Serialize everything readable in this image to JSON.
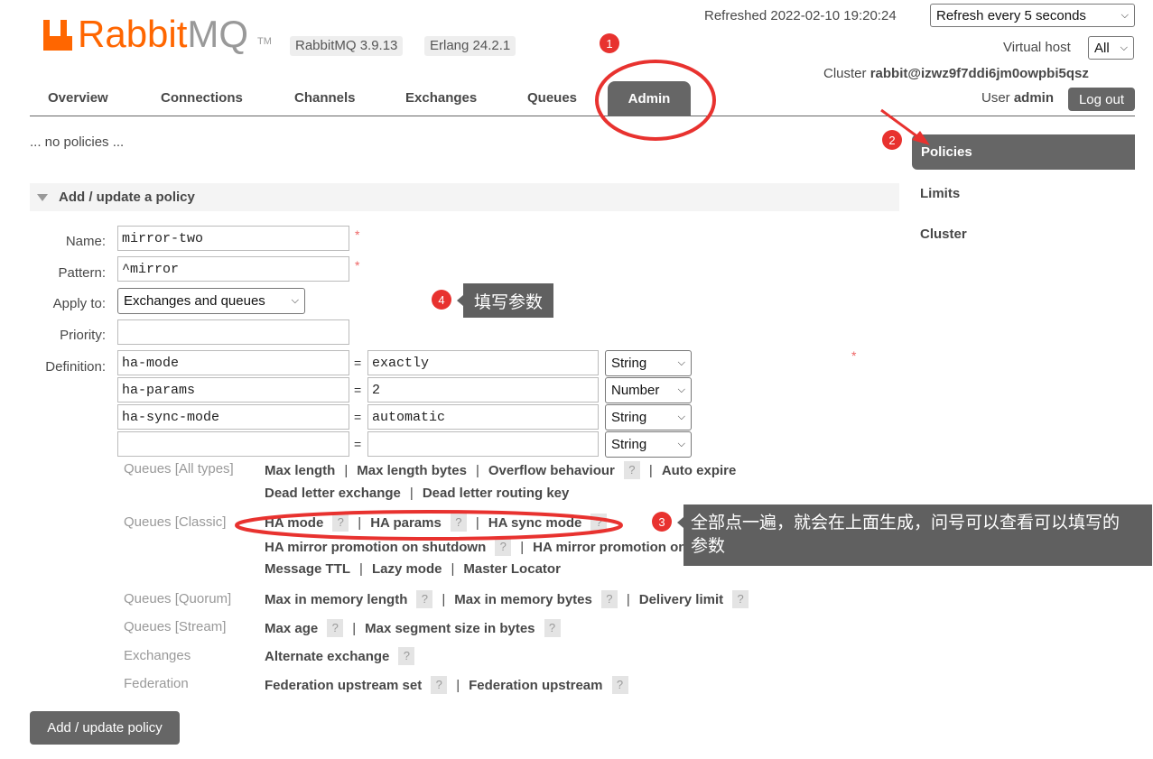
{
  "header": {
    "logo_text_1": "Rabbit",
    "logo_text_2": "MQ",
    "tm": "TM",
    "version": "RabbitMQ 3.9.13",
    "erlang": "Erlang 24.2.1",
    "refreshed_label": "Refreshed 2022-02-10 19:20:24",
    "refresh_select": "Refresh every 5 seconds",
    "vhost_label": "Virtual host",
    "vhost_select": "All",
    "cluster_label": "Cluster",
    "cluster_name": "rabbit@izwz9f7ddi6jm0owpbi5qsz",
    "user_label": "User",
    "user_name": "admin",
    "logout": "Log out"
  },
  "tabs": [
    "Overview",
    "Connections",
    "Channels",
    "Exchanges",
    "Queues",
    "Admin"
  ],
  "sidebar": {
    "items": [
      "Policies",
      "Limits",
      "Cluster"
    ]
  },
  "main": {
    "no_policies": "... no policies ...",
    "section_title": "Add / update a policy",
    "form": {
      "name_label": "Name:",
      "name_value": "mirror-two",
      "pattern_label": "Pattern:",
      "pattern_value": "^mirror",
      "apply_label": "Apply to:",
      "apply_value": "Exchanges and queues",
      "priority_label": "Priority:",
      "priority_value": "",
      "definition_label": "Definition:",
      "required": "*",
      "equals": "=",
      "definition": [
        {
          "key": "ha-mode",
          "value": "exactly",
          "type": "String"
        },
        {
          "key": "ha-params",
          "value": "2",
          "type": "Number"
        },
        {
          "key": "ha-sync-mode",
          "value": "automatic",
          "type": "String"
        },
        {
          "key": "",
          "value": "",
          "type": "String"
        }
      ]
    },
    "help": {
      "cat_all": "Queues [All types]",
      "cat_classic": "Queues [Classic]",
      "cat_quorum": "Queues [Quorum]",
      "cat_stream": "Queues [Stream]",
      "cat_exchanges": "Exchanges",
      "cat_federation": "Federation",
      "q": "?",
      "sep": "|",
      "all_1": "Max length",
      "all_2": "Max length bytes",
      "all_3": "Overflow behaviour",
      "all_4": "Auto expire",
      "all_5": "Dead letter exchange",
      "all_6": "Dead letter routing key",
      "classic_1": "HA mode",
      "classic_2": "HA params",
      "classic_3": "HA sync mode",
      "classic_4": "HA mirror promotion on shutdown",
      "classic_5": "HA mirror promotion on failure",
      "classic_6": "Message TTL",
      "classic_7": "Lazy mode",
      "classic_8": "Master Locator",
      "quorum_1": "Max in memory length",
      "quorum_2": "Max in memory bytes",
      "quorum_3": "Delivery limit",
      "stream_1": "Max age",
      "stream_2": "Max segment size in bytes",
      "exch_1": "Alternate exchange",
      "fed_1": "Federation upstream set",
      "fed_2": "Federation upstream"
    },
    "submit": "Add / update policy"
  },
  "annotations": {
    "n1": "1",
    "n2": "2",
    "n3": "3",
    "n4": "4",
    "tip4": "填写参数",
    "tip3_line1": "全部点一遍，就会在上面生成，问号可以查看可以填写的",
    "tip3_line2": "参数",
    "highlight_color": "#e8322f"
  }
}
